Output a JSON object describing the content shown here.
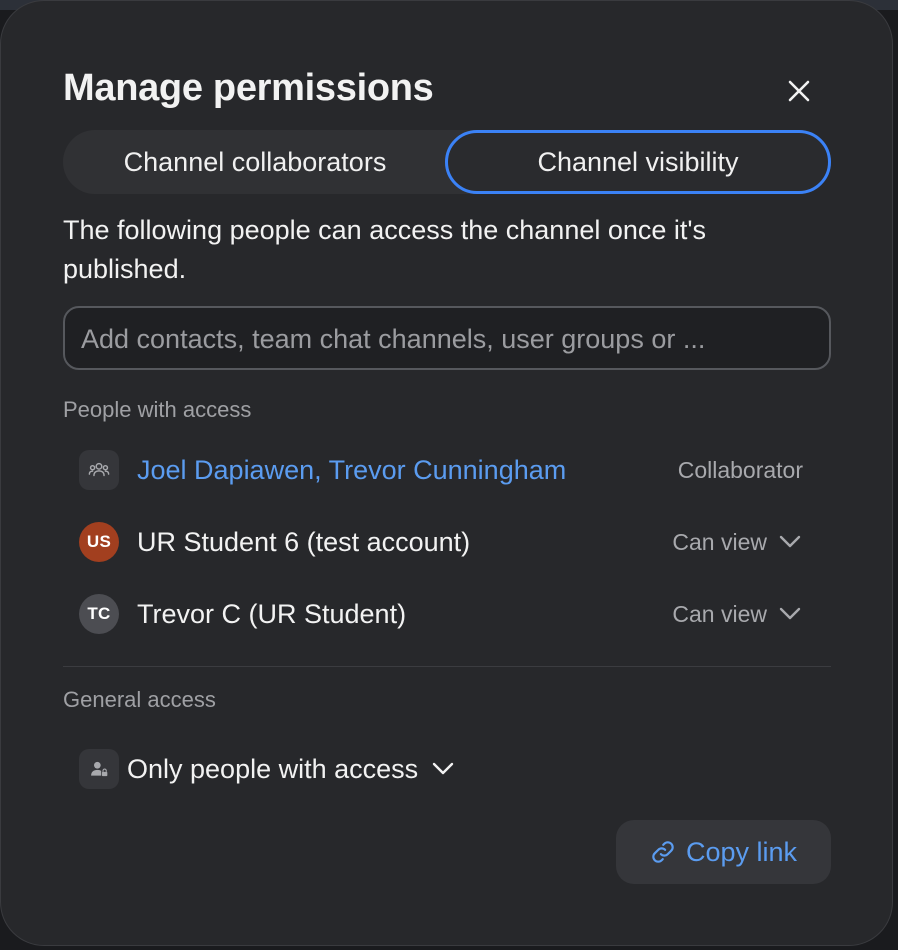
{
  "dialog": {
    "title": "Manage permissions",
    "tabs": [
      {
        "label": "Channel collaborators",
        "active": false
      },
      {
        "label": "Channel visibility",
        "active": true
      }
    ],
    "description": "The following people can access the channel once it's published.",
    "search": {
      "placeholder": "Add contacts, team chat channels, user groups or ...",
      "value": ""
    },
    "people_section_label": "People with access",
    "people": [
      {
        "name": "Joel Dapiawen, Trevor Cunningham",
        "role": "Collaborator",
        "icon": "group-icon"
      },
      {
        "name": "UR Student 6 (test account)",
        "initials": "US",
        "avatar_color": "#a23f1f",
        "permission": "Can view"
      },
      {
        "name": "Trevor C (UR Student)",
        "initials": "TC",
        "avatar_color": "#4c4d52",
        "permission": "Can view"
      }
    ],
    "general_section_label": "General access",
    "general_access": {
      "value": "Only people with access",
      "icon": "person-lock-icon"
    },
    "copy_link_label": "Copy link"
  },
  "colors": {
    "accent": "#3b82f6",
    "link": "#5b9cf0",
    "background": "#27282b"
  }
}
